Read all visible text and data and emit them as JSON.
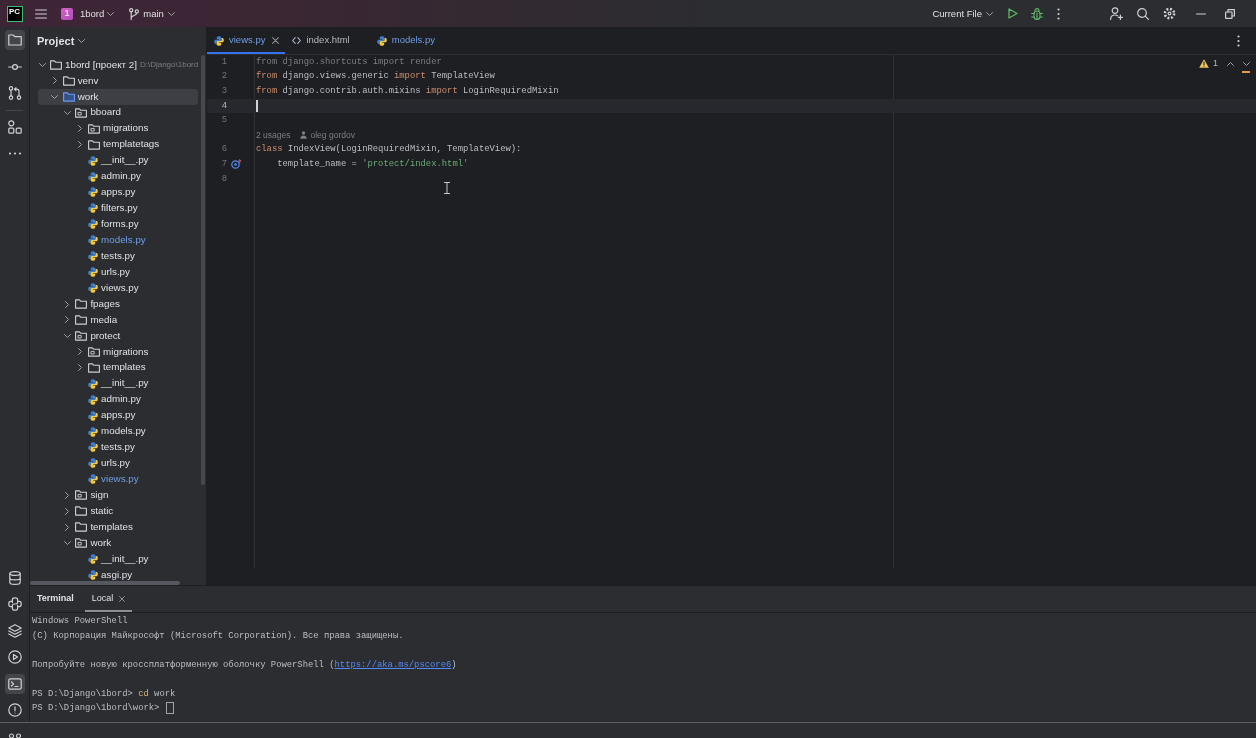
{
  "title_bar": {
    "logo": "PC",
    "project_badge": "1",
    "project": "1bord",
    "branch": "main",
    "run_config": "Current File"
  },
  "tool_strip": {
    "top_groups": [
      {
        "buttons": [
          {
            "kind": "project",
            "selected": true
          },
          {
            "kind": "commit",
            "selected": false
          },
          {
            "kind": "pull_requests",
            "selected": false
          }
        ]
      },
      {
        "buttons": [
          {
            "kind": "structure",
            "selected": false
          },
          {
            "kind": "more",
            "selected": false
          }
        ]
      }
    ],
    "bottom": [
      {
        "kind": "database",
        "selected": false
      },
      {
        "kind": "python_console",
        "selected": false
      },
      {
        "kind": "layers",
        "selected": false
      },
      {
        "kind": "services",
        "selected": false
      },
      {
        "kind": "terminal",
        "selected": true
      },
      {
        "kind": "problems",
        "selected": false
      }
    ]
  },
  "project_panel": {
    "title": "Project",
    "tree": [
      {
        "label": "1bord [проект 2]",
        "path": "D:\\Django\\1bord",
        "kind": "folder",
        "expanded": true,
        "selected": false,
        "modified": false,
        "children": [
          {
            "label": "venv",
            "kind": "folder",
            "expanded": false,
            "selected": false,
            "modified": false
          },
          {
            "label": "work",
            "kind": "source_root",
            "expanded": true,
            "selected": true,
            "modified": false,
            "children": [
              {
                "label": "bboard",
                "kind": "package",
                "expanded": true,
                "selected": false,
                "modified": false,
                "children": [
                  {
                    "label": "migrations",
                    "kind": "package",
                    "expanded": false,
                    "selected": false,
                    "modified": false
                  },
                  {
                    "label": "templatetags",
                    "kind": "folder",
                    "expanded": false,
                    "selected": false,
                    "modified": false
                  },
                  {
                    "label": "__init__.py",
                    "kind": "python",
                    "selected": false,
                    "modified": false
                  },
                  {
                    "label": "admin.py",
                    "kind": "python",
                    "selected": false,
                    "modified": false
                  },
                  {
                    "label": "apps.py",
                    "kind": "python",
                    "selected": false,
                    "modified": false
                  },
                  {
                    "label": "filters.py",
                    "kind": "python",
                    "selected": false,
                    "modified": false
                  },
                  {
                    "label": "forms.py",
                    "kind": "python",
                    "selected": false,
                    "modified": false
                  },
                  {
                    "label": "models.py",
                    "kind": "python",
                    "selected": false,
                    "modified": true
                  },
                  {
                    "label": "tests.py",
                    "kind": "python",
                    "selected": false,
                    "modified": false
                  },
                  {
                    "label": "urls.py",
                    "kind": "python",
                    "selected": false,
                    "modified": false
                  },
                  {
                    "label": "views.py",
                    "kind": "python",
                    "selected": false,
                    "modified": false
                  }
                ]
              },
              {
                "label": "fpages",
                "kind": "folder",
                "expanded": false,
                "selected": false,
                "modified": false
              },
              {
                "label": "media",
                "kind": "folder",
                "expanded": false,
                "selected": false,
                "modified": false
              },
              {
                "label": "protect",
                "kind": "package",
                "expanded": true,
                "selected": false,
                "modified": false,
                "children": [
                  {
                    "label": "migrations",
                    "kind": "package",
                    "expanded": false,
                    "selected": false,
                    "modified": false
                  },
                  {
                    "label": "templates",
                    "kind": "folder",
                    "expanded": false,
                    "selected": false,
                    "modified": false
                  },
                  {
                    "label": "__init__.py",
                    "kind": "python",
                    "selected": false,
                    "modified": false
                  },
                  {
                    "label": "admin.py",
                    "kind": "python",
                    "selected": false,
                    "modified": false
                  },
                  {
                    "label": "apps.py",
                    "kind": "python",
                    "selected": false,
                    "modified": false
                  },
                  {
                    "label": "models.py",
                    "kind": "python",
                    "selected": false,
                    "modified": false
                  },
                  {
                    "label": "tests.py",
                    "kind": "python",
                    "selected": false,
                    "modified": false
                  },
                  {
                    "label": "urls.py",
                    "kind": "python",
                    "selected": false,
                    "modified": false
                  },
                  {
                    "label": "views.py",
                    "kind": "python",
                    "selected": false,
                    "modified": true
                  }
                ]
              },
              {
                "label": "sign",
                "kind": "package",
                "expanded": false,
                "selected": false,
                "modified": false
              },
              {
                "label": "static",
                "kind": "folder",
                "expanded": false,
                "selected": false,
                "modified": false
              },
              {
                "label": "templates",
                "kind": "folder",
                "expanded": false,
                "selected": false,
                "modified": false
              },
              {
                "label": "work",
                "kind": "package",
                "expanded": true,
                "selected": false,
                "modified": false,
                "children": [
                  {
                    "label": "__init__.py",
                    "kind": "python",
                    "selected": false,
                    "modified": false
                  },
                  {
                    "label": "asgi.py",
                    "kind": "python",
                    "selected": false,
                    "modified": false
                  }
                ]
              }
            ]
          }
        ]
      }
    ]
  },
  "editor": {
    "tabs": [
      {
        "label": "views.py",
        "kind": "python",
        "selected": true,
        "modified": true
      },
      {
        "label": "index.html",
        "kind": "html",
        "selected": false,
        "modified": false
      },
      {
        "label": "models.py",
        "kind": "python",
        "selected": false,
        "modified": true
      }
    ],
    "inspection": {
      "warnings": "1"
    },
    "lines": [
      {
        "kind": "code",
        "number": "1",
        "current": false,
        "gutter_marker": false,
        "tokens": [
          {
            "kind": "unused",
            "text": "from django.shortcuts import render"
          }
        ]
      },
      {
        "kind": "code",
        "number": "2",
        "current": false,
        "gutter_marker": false,
        "tokens": [
          {
            "kind": "keyword",
            "text": "from"
          },
          {
            "kind": "plain",
            "text": " django.views.generic "
          },
          {
            "kind": "keyword",
            "text": "import"
          },
          {
            "kind": "plain",
            "text": " TemplateView"
          }
        ]
      },
      {
        "kind": "code",
        "number": "3",
        "current": false,
        "gutter_marker": false,
        "tokens": [
          {
            "kind": "keyword",
            "text": "from"
          },
          {
            "kind": "plain",
            "text": " django.contrib.auth.mixins "
          },
          {
            "kind": "keyword",
            "text": "import"
          },
          {
            "kind": "plain",
            "text": " LoginRequiredMixin"
          }
        ]
      },
      {
        "kind": "code",
        "number": "4",
        "current": true,
        "gutter_marker": false
      },
      {
        "kind": "code",
        "number": "5",
        "current": false,
        "gutter_marker": false
      },
      {
        "kind": "inlay",
        "usages": "2 usages",
        "author": "oleg gordov"
      },
      {
        "kind": "code",
        "number": "6",
        "current": false,
        "gutter_marker": false,
        "tokens": [
          {
            "kind": "keyword",
            "text": "class"
          },
          {
            "kind": "plain",
            "text": " IndexView(LoginRequiredMixin, TemplateView):"
          }
        ]
      },
      {
        "kind": "code",
        "number": "7",
        "current": false,
        "gutter_marker": true,
        "tokens": [
          {
            "kind": "plain",
            "text": "    template_name = "
          },
          {
            "kind": "string",
            "text": "'protect/index.html'"
          }
        ]
      },
      {
        "kind": "code",
        "number": "8",
        "current": false,
        "gutter_marker": false
      }
    ]
  },
  "terminal": {
    "title": "Terminal",
    "tabs": [
      {
        "label": "Local",
        "selected": true
      }
    ],
    "blocks": [
      {
        "lines": [
          {
            "tokens": [
              {
                "kind": "plain",
                "text": "Windows PowerShell"
              }
            ]
          },
          {
            "tokens": [
              {
                "kind": "plain",
                "text": "(C) Корпорация Майкрософт (Microsoft Corporation). Все права защищены."
              }
            ]
          }
        ]
      },
      {
        "lines": [
          {
            "tokens": [
              {
                "kind": "plain",
                "text": "Попробуйте новую кроссплатформенную оболочку PowerShell ("
              },
              {
                "kind": "link",
                "text": "https://aka.ms/pscore6"
              },
              {
                "kind": "plain",
                "text": ")"
              }
            ]
          }
        ]
      },
      {
        "lines": [
          {
            "tokens": [
              {
                "kind": "plain",
                "text": "PS D:\\Django\\1bord> "
              },
              {
                "kind": "command",
                "text": "cd"
              },
              {
                "kind": "plain",
                "text": " work"
              }
            ]
          },
          {
            "tokens": [
              {
                "kind": "plain",
                "text": "PS D:\\Django\\1bord\\work> "
              },
              {
                "kind": "cursor"
              }
            ]
          }
        ]
      }
    ]
  }
}
